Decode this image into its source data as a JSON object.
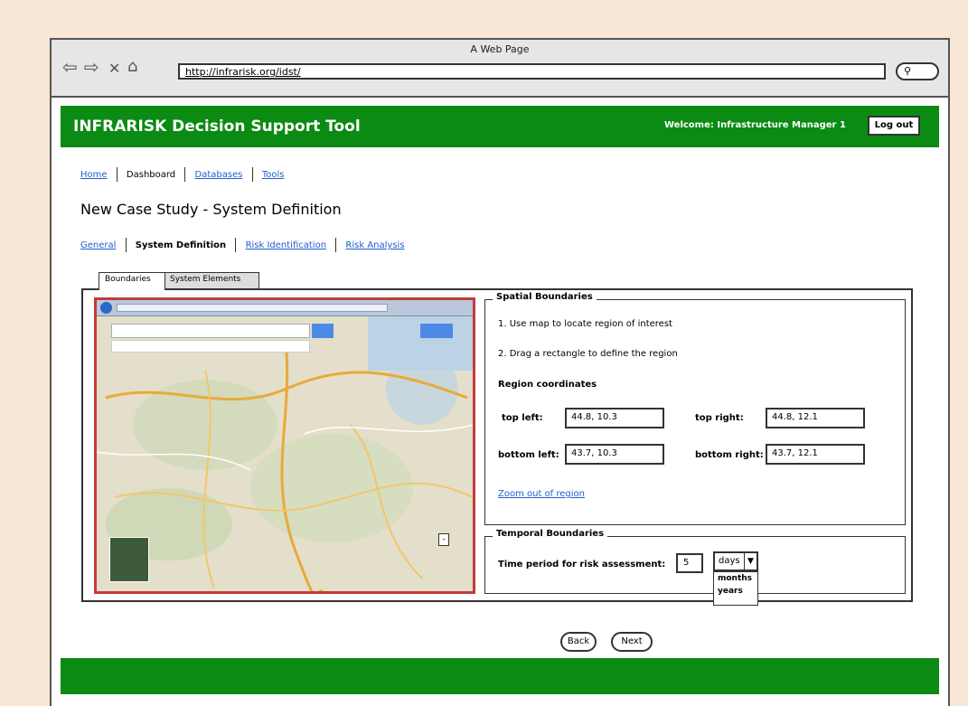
{
  "browser": {
    "window_title": "A Web Page",
    "url": "http://infrarisk.org/idst/",
    "back_icon": "arrow-left-icon",
    "forward_icon": "arrow-right-icon",
    "close_icon": "x-icon",
    "home_icon": "home-icon",
    "search_icon": "magnifier-icon"
  },
  "header": {
    "title": "INFRARISK Decision Support Tool",
    "welcome": "Welcome: Infrastructure Manager 1",
    "logout": "Log out",
    "color": "#0b8a14"
  },
  "main_nav": {
    "home": "Home",
    "dashboard": "Dashboard",
    "databases": "Databases",
    "tools": "Tools"
  },
  "page_title": "New Case Study - System Definition",
  "sub_nav": {
    "general": "General",
    "system_definition": "System Definition",
    "risk_identification": "Risk Identification",
    "risk_analysis": "Risk Analysis"
  },
  "tabs": {
    "boundaries": "Boundaries",
    "system_elements": "System Elements"
  },
  "spatial": {
    "legend": "Spatial Boundaries",
    "step1": "1. Use map to locate region of interest",
    "step2": "2. Drag a rectangle to define the region",
    "coords_heading": "Region coordinates",
    "top_left_label": "top left:",
    "top_left_value": "44.8, 10.3",
    "top_right_label": "top right:",
    "top_right_value": "44.8, 12.1",
    "bottom_left_label": "bottom left:",
    "bottom_left_value": "43.7, 10.3",
    "bottom_right_label": "bottom right:",
    "bottom_right_value": "43.7, 12.1",
    "zoom_out_link": "Zoom out of region"
  },
  "temporal": {
    "legend": "Temporal Boundaries",
    "label": "Time period for risk assessment:",
    "value": "5",
    "unit_selected": "days",
    "unit_options": [
      "months",
      "years"
    ]
  },
  "buttons": {
    "back": "Back",
    "next": "Next"
  },
  "map": {
    "border_color": "#c43b3b"
  }
}
